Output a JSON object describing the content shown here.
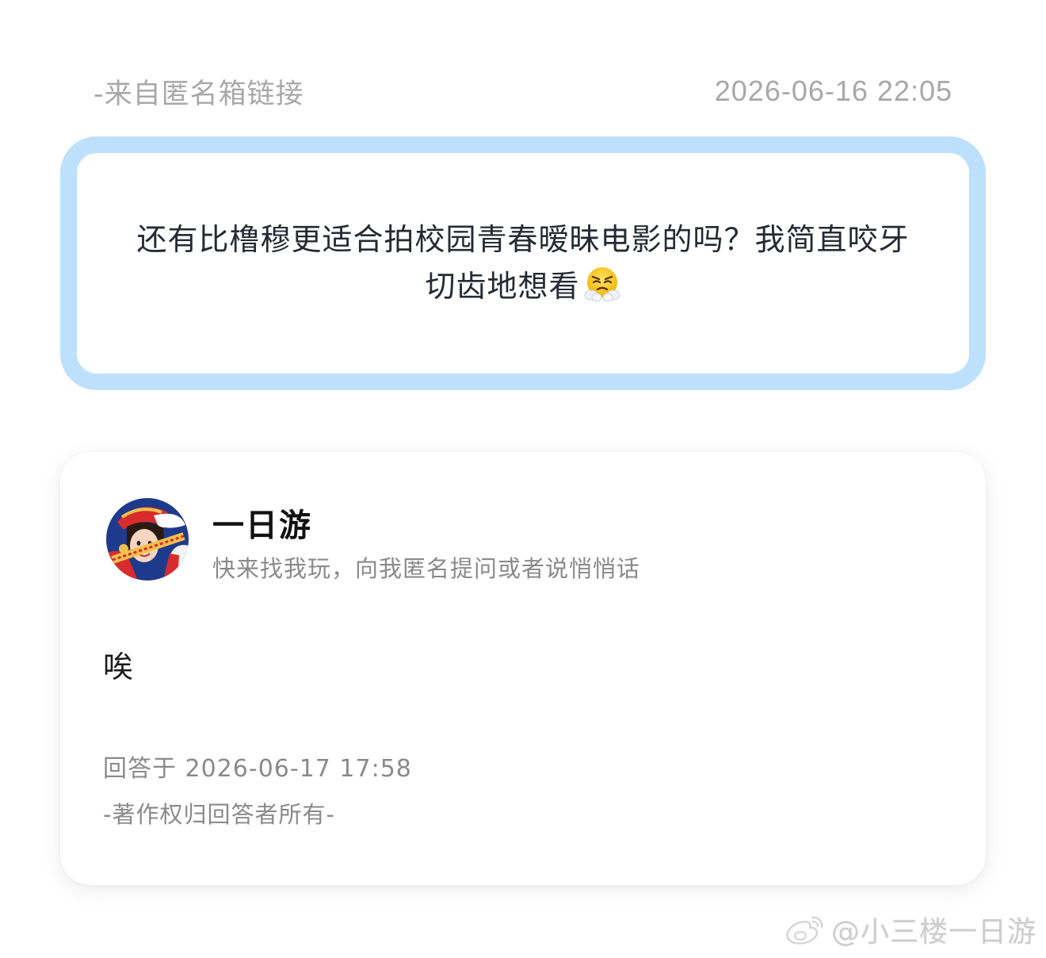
{
  "meta": {
    "source": "-来自匿名箱链接",
    "time": "2026-06-16 22:05"
  },
  "question": {
    "text": "还有比橹穆更适合拍校园青春暧昧电影的吗？我简直咬牙切齿地想看",
    "emoji_icon": "face-with-steam-icon"
  },
  "answer": {
    "user_name": "一日游",
    "user_bio": "快来找我玩，向我匿名提问或者说悄悄话",
    "text": "唉",
    "time": "回答于 2026-06-17 17:58",
    "copyright": "-著作权归回答者所有-"
  },
  "watermark": {
    "text": "@小三楼一日游",
    "icon": "weibo-icon"
  },
  "colors": {
    "question_border": "#bde0fc",
    "meta_text": "#a8a8a8",
    "secondary_text": "#8a8a8a"
  }
}
